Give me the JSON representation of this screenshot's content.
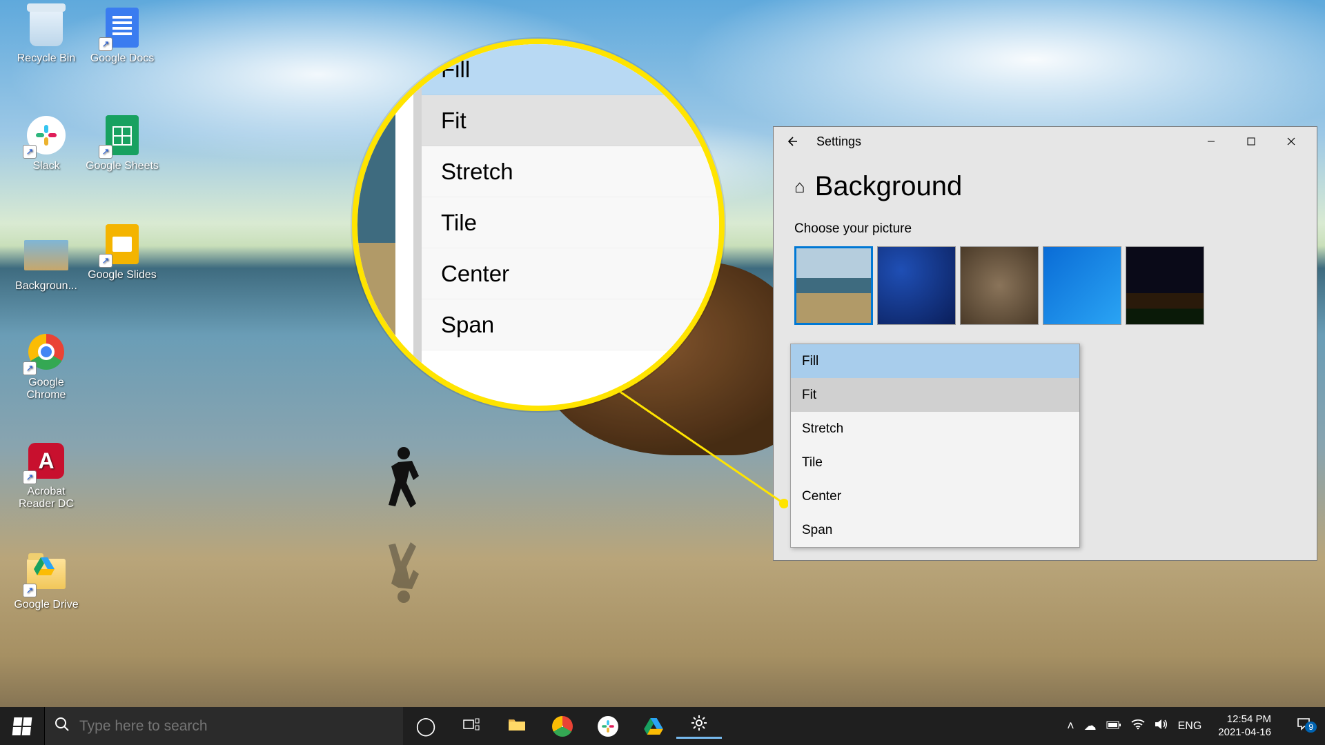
{
  "desktop_icons": {
    "recycle_bin": "Recycle Bin",
    "google_docs": "Google Docs",
    "slack": "Slack",
    "google_sheets": "Google Sheets",
    "background": "Backgroun...",
    "google_slides": "Google Slides",
    "google_chrome": "Google Chrome",
    "acrobat": "Acrobat Reader DC",
    "google_drive": "Google Drive"
  },
  "settings_window": {
    "title": "Settings",
    "page_title": "Background",
    "choose_label": "Choose your picture",
    "fit_options": [
      "Fill",
      "Fit",
      "Stretch",
      "Tile",
      "Center",
      "Span"
    ],
    "selected_fit": "Fill",
    "hovered_fit": "Fit"
  },
  "magnifier": {
    "options": [
      "Fill",
      "Fit",
      "Stretch",
      "Tile",
      "Center",
      "Span"
    ],
    "selected": "Fill",
    "hovered": "Fit"
  },
  "taskbar": {
    "search_placeholder": "Type here to search",
    "lang": "ENG",
    "time": "12:54 PM",
    "date": "2021-04-16",
    "action_center_badge": "9"
  }
}
